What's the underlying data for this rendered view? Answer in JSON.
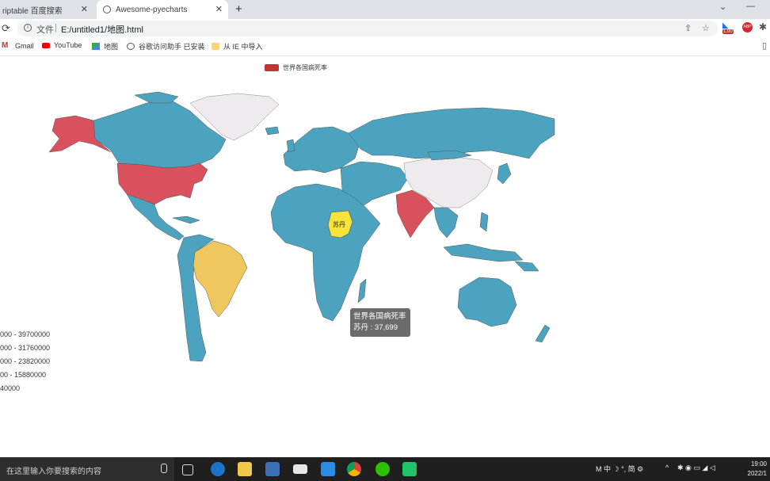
{
  "browser": {
    "tabs": [
      {
        "title": "riptable 百度搜索",
        "active": false
      },
      {
        "title": "Awesome-pyecharts",
        "active": true
      }
    ],
    "scheme_label": "文件",
    "url": "E:/untitled1/地图.html",
    "extension_badge": "1.00",
    "bookmarks": [
      {
        "label": "Gmail",
        "icon": "gmail-icon"
      },
      {
        "label": "YouTube",
        "icon": "youtube-icon"
      },
      {
        "label": "地图",
        "icon": "maps-icon"
      },
      {
        "label": "谷歌访问助手 已安装",
        "icon": "globe-icon"
      },
      {
        "label": "从 IE 中导入",
        "icon": "folder-icon"
      }
    ]
  },
  "chart": {
    "legend": "世界各国病死率",
    "series_color": "#c23531",
    "visual_map": [
      "000 - 39700000",
      "000 - 31760000",
      "000 - 23820000",
      "00 - 15880000",
      "40000"
    ],
    "tooltip": {
      "series": "世界各国病死率",
      "line": "苏丹 : 37,699"
    },
    "highlight_label": "苏丹"
  },
  "chart_data": {
    "type": "map",
    "series_name": "世界各国病死率",
    "highlighted": {
      "name": "苏丹",
      "value": 37699
    },
    "colors": {
      "base": "#4ba3bf",
      "red": "#d9515d",
      "yellow": "#f0c75e",
      "highlight": "#f6e43b",
      "nodata": "#efeaee"
    }
  },
  "taskbar": {
    "search_placeholder": "在这里输入你要搜索的内容",
    "clock_time": "19:00",
    "clock_date": "2022/1"
  }
}
